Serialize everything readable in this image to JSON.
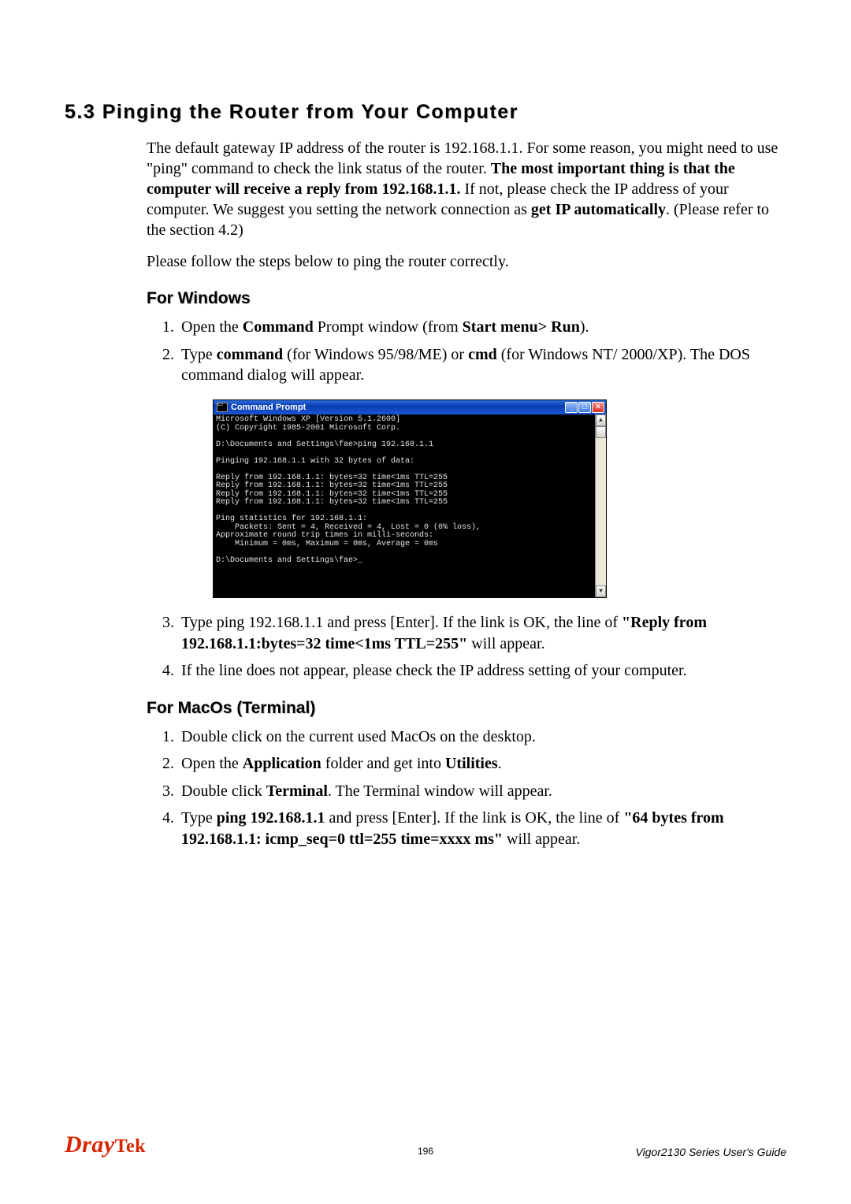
{
  "section": {
    "number": "5.3",
    "title": "Pinging the Router from Your Computer"
  },
  "intro": {
    "p1_pre": "The default gateway IP address of the router is 192.168.1.1. For some reason, you might need to use \"ping\" command to check the link status of the router. ",
    "p1_bold": "The most important thing is that the computer will receive a reply from 192.168.1.1.",
    "p1_mid": " If not, please check the IP address of your computer. We suggest you setting the network connection as ",
    "p1_bold2": "get IP automatically",
    "p1_post": ". (Please refer to the section 4.2)",
    "p2": "Please follow the steps below to ping the router correctly."
  },
  "windows": {
    "heading": "For Windows",
    "steps": {
      "s1_a": "Open the ",
      "s1_b": "Command",
      "s1_c": " Prompt window (from ",
      "s1_d": "Start menu> Run",
      "s1_e": ").",
      "s2_a": "Type ",
      "s2_b": "command",
      "s2_c": " (for Windows 95/98/ME) or ",
      "s2_d": "cmd",
      "s2_e": " (for Windows NT/ 2000/XP). The DOS command dialog will appear.",
      "s3_a": "Type ping 192.168.1.1 and press [Enter]. If the link is OK, the line of ",
      "s3_b": "\"Reply from 192.168.1.1:bytes=32 time<1ms TTL=255\"",
      "s3_c": " will appear.",
      "s4": "If the line does not appear, please check the IP address setting of your computer."
    }
  },
  "cmd": {
    "title": "Command Prompt",
    "btn_min": "_",
    "btn_max": "□",
    "btn_close": "×",
    "scroll_up": "▲",
    "scroll_down": "▼",
    "lines": "Microsoft Windows XP [Version 5.1.2600]\n(C) Copyright 1985-2001 Microsoft Corp.\n\nD:\\Documents and Settings\\fae>ping 192.168.1.1\n\nPinging 192.168.1.1 with 32 bytes of data:\n\nReply from 192.168.1.1: bytes=32 time<1ms TTL=255\nReply from 192.168.1.1: bytes=32 time<1ms TTL=255\nReply from 192.168.1.1: bytes=32 time<1ms TTL=255\nReply from 192.168.1.1: bytes=32 time<1ms TTL=255\n\nPing statistics for 192.168.1.1:\n    Packets: Sent = 4, Received = 4, Lost = 0 (0% loss),\nApproximate round trip times in milli-seconds:\n    Minimum = 0ms, Maximum = 0ms, Average = 0ms\n\nD:\\Documents and Settings\\fae>_"
  },
  "macos": {
    "heading": "For MacOs (Terminal)",
    "steps": {
      "s1": "Double click on the current used MacOs on the desktop.",
      "s2_a": "Open the ",
      "s2_b": "Application",
      "s2_c": " folder and get into ",
      "s2_d": "Utilities",
      "s2_e": ".",
      "s3_a": "Double click ",
      "s3_b": "Terminal",
      "s3_c": ". The Terminal window will appear.",
      "s4_a": "Type ",
      "s4_b": "ping 192.168.1.1",
      "s4_c": " and press [Enter]. If the link is OK, the line of ",
      "s4_d": "\"64 bytes from 192.168.1.1: icmp_seq=0 ttl=255 time=xxxx ms\"",
      "s4_e": " will appear."
    }
  },
  "footer": {
    "logo_main": "Dray",
    "logo_tek": "Tek",
    "page": "196",
    "guide": "Vigor2130  Series  User's  Guide"
  }
}
